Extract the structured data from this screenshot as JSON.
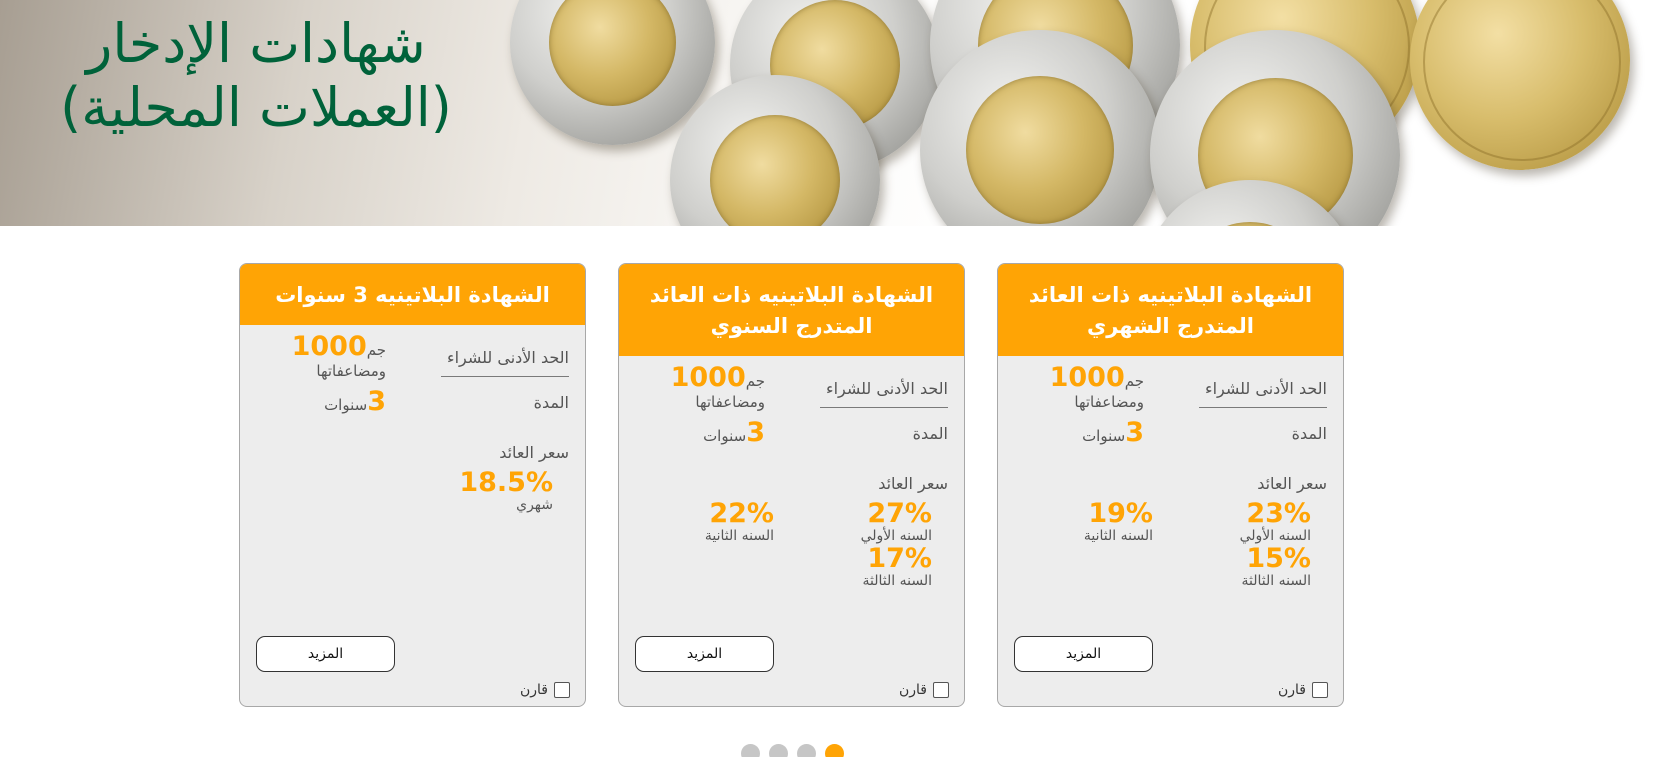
{
  "banner": {
    "title_line1": "شهادات الإدخار",
    "title_line2": "(العملات المحلية)"
  },
  "cards": [
    {
      "title": "الشهادة البلاتينيه ذات العائد المتدرج الشهري",
      "min_label": "الحد الأدنى للشراء",
      "min_amount": "1000",
      "min_currency": "جم",
      "min_note": "ومضاعفاتها",
      "duration_label": "المدة",
      "duration_value": "3",
      "duration_unit": "سنوات",
      "rate_label": "سعر العائد",
      "rates": [
        {
          "pct": "23%",
          "year": "السنه الأولي"
        },
        {
          "pct": "19%",
          "year": "السنه الثانية"
        },
        {
          "pct": "15%",
          "year": "السنه الثالثة"
        }
      ],
      "more_label": "المزيد",
      "compare_label": "قارن"
    },
    {
      "title": "الشهادة البلاتينيه ذات العائد المتدرج السنوي",
      "min_label": "الحد الأدنى للشراء",
      "min_amount": "1000",
      "min_currency": "جم",
      "min_note": "ومضاعفاتها",
      "duration_label": "المدة",
      "duration_value": "3",
      "duration_unit": "سنوات",
      "rate_label": "سعر العائد",
      "rates": [
        {
          "pct": "27%",
          "year": "السنه الأولي"
        },
        {
          "pct": "22%",
          "year": "السنه الثانية"
        },
        {
          "pct": "17%",
          "year": "السنه الثالثة"
        }
      ],
      "more_label": "المزيد",
      "compare_label": "قارن"
    },
    {
      "title": "الشهادة البلاتينيه 3 سنوات",
      "min_label": "الحد الأدنى للشراء",
      "min_amount": "1000",
      "min_currency": "جم",
      "min_note": "ومضاعفاتها",
      "duration_label": "المدة",
      "duration_value": "3",
      "duration_unit": "سنوات",
      "rate_label": "سعر العائد",
      "rate_value": "18.5%",
      "rate_period": "شهري",
      "more_label": "المزيد",
      "compare_label": "قارن"
    }
  ],
  "pager": {
    "count": 4,
    "active_index": 3
  },
  "colors": {
    "brand_green": "#00623a",
    "accent_orange": "#ffa405",
    "card_bg": "#ededed"
  }
}
